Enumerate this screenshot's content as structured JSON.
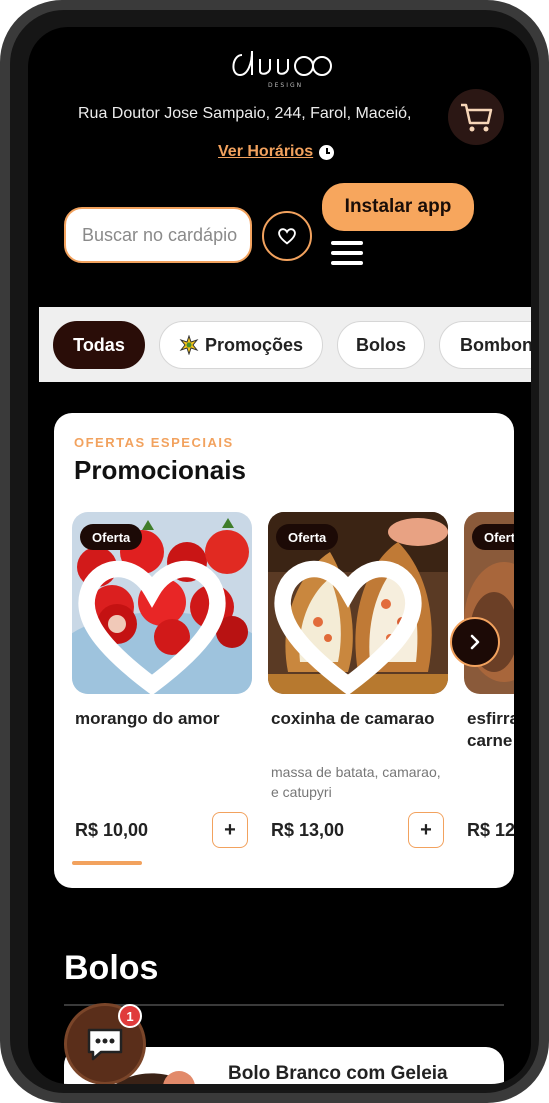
{
  "header": {
    "address": "Rua Doutor Jose Sampaio, 244, Farol, Maceió,",
    "hours_link": "Ver Horários",
    "search_placeholder": "Buscar no cardápio",
    "install_label": "Instalar app"
  },
  "categories": [
    {
      "label": "Todas",
      "active": true
    },
    {
      "label": "Promoções",
      "icon": "star-badge-icon"
    },
    {
      "label": "Bolos"
    },
    {
      "label": "Bombons"
    }
  ],
  "promo": {
    "eyebrow": "OFERTAS ESPECIAIS",
    "title": "Promocionais",
    "products": [
      {
        "tag": "Oferta",
        "name": "morango do amor",
        "description": "",
        "price": "R$ 10,00",
        "add": "+"
      },
      {
        "tag": "Oferta",
        "name": "coxinha de camarao",
        "description": "massa de batata, camarao, e catupyri",
        "price": "R$ 13,00",
        "add": "+"
      },
      {
        "tag": "Oferta",
        "name": "esfirra de carne de sol, c",
        "description": "",
        "price": "R$ 12",
        "add": "+"
      }
    ]
  },
  "bolos": {
    "title": "Bolos",
    "first_item": "Bolo Branco com Geleia"
  },
  "chat": {
    "badge": "1"
  },
  "colors": {
    "accent": "#f2a25e",
    "dark_brown": "#1c0a06",
    "background": "#000000"
  }
}
